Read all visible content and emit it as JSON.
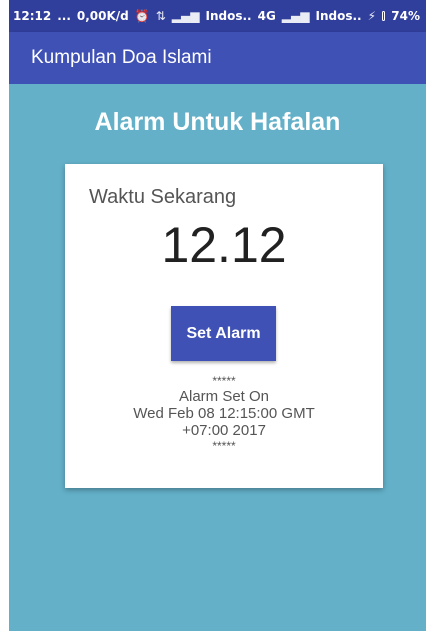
{
  "status_bar": {
    "time": "12:12",
    "dots": "...",
    "net_speed": "0,00K/d",
    "carrier1": "Indos..",
    "network_type": "4G",
    "carrier2": "Indos..",
    "battery": "74%",
    "battery_level": 0.74
  },
  "app_bar": {
    "title": "Kumpulan Doa Islami"
  },
  "main": {
    "heading": "Alarm Untuk Hafalan",
    "card": {
      "label": "Waktu Sekarang",
      "time": "12.12",
      "button_label": "Set Alarm",
      "stars_top": "*****",
      "info_line1": "Alarm Set On",
      "info_line2": "Wed Feb 08 12:15:00 GMT",
      "info_line3": "+07:00 2017",
      "stars_bottom": "*****"
    }
  },
  "colors": {
    "primary": "#3f51b5",
    "primary_dark": "#313f9c",
    "background": "#63b0c8",
    "battery": "#3ddc5a"
  }
}
